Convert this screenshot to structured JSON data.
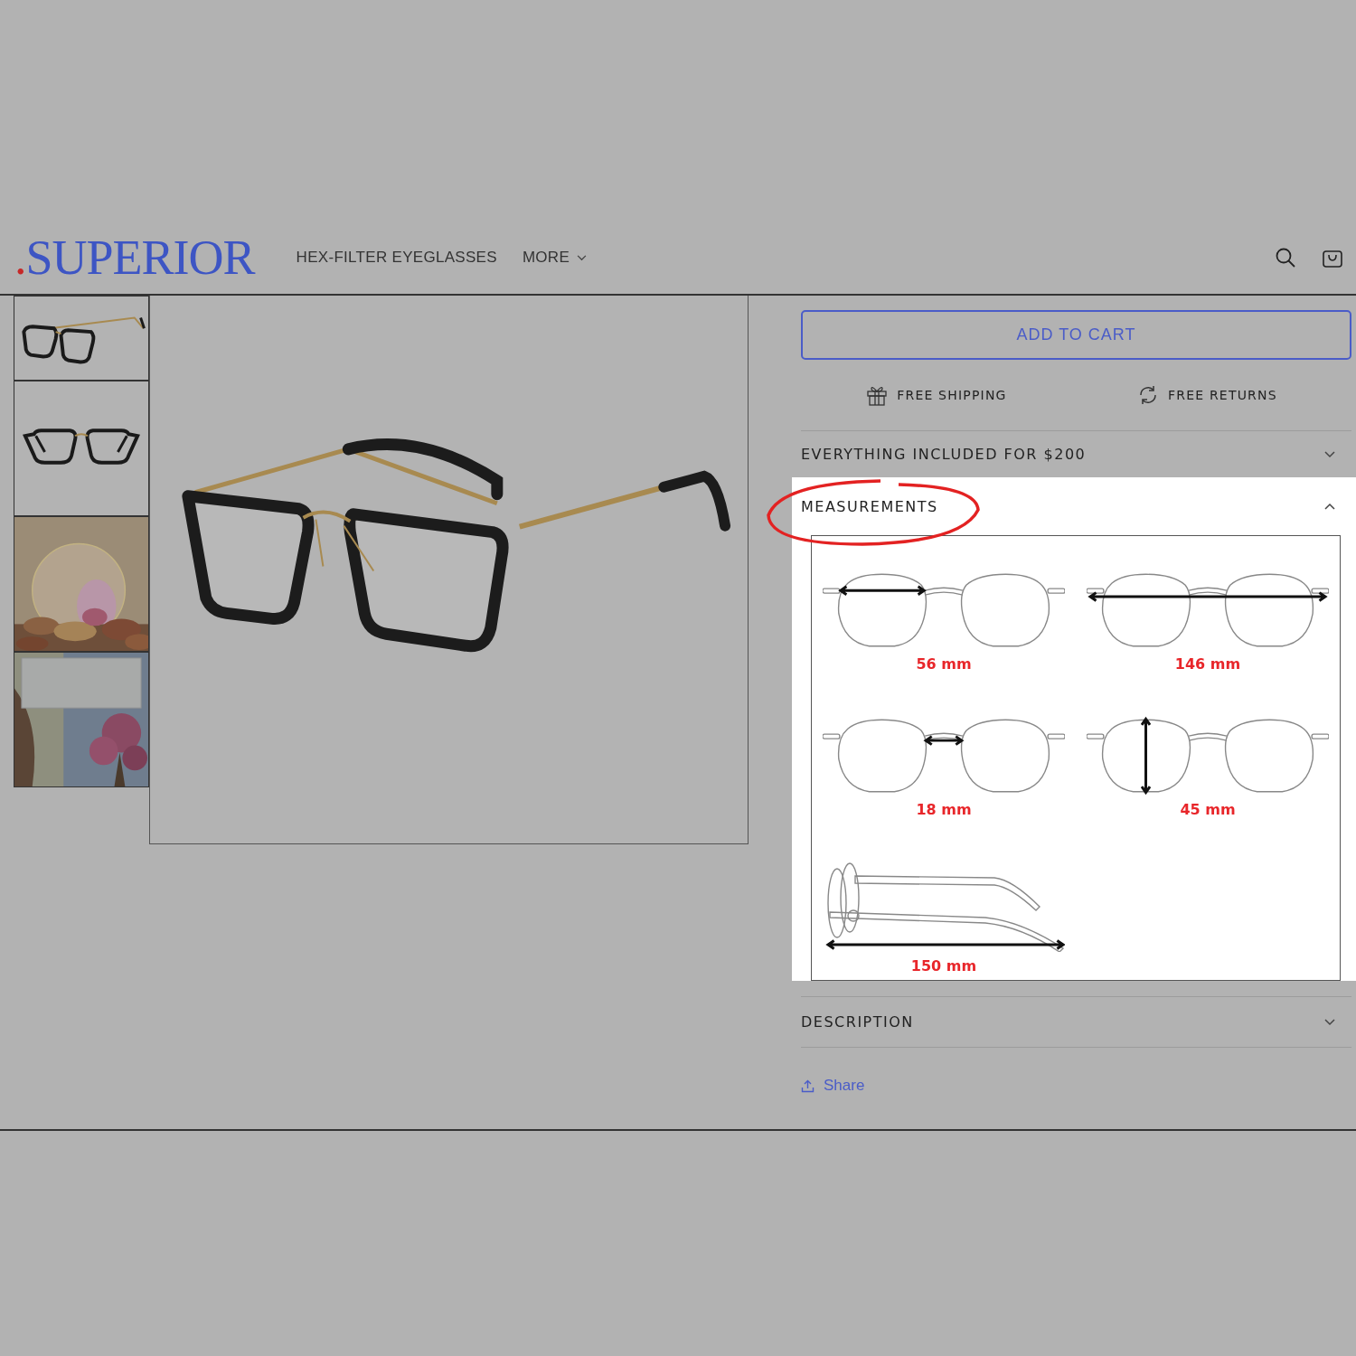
{
  "header": {
    "logo": {
      "dot": ".",
      "name": "SUPERIOR"
    },
    "nav": [
      {
        "label": "HEX-FILTER EYEGLASSES",
        "dropdown": false
      },
      {
        "label": "MORE",
        "dropdown": true
      }
    ]
  },
  "product": {
    "add_to_cart": "ADD TO CART",
    "benefits": [
      {
        "kind": "gift",
        "label": "FREE SHIPPING"
      },
      {
        "kind": "returns",
        "label": "FREE RETURNS"
      }
    ],
    "accordions": [
      {
        "title": "EVERYTHING INCLUDED FOR $200",
        "expanded": false,
        "highlighted": false
      },
      {
        "title": "MEASUREMENTS",
        "expanded": true,
        "highlighted": true,
        "measurements": [
          {
            "kind": "lens-width",
            "label": "56 mm"
          },
          {
            "kind": "frame-width",
            "label": "146 mm"
          },
          {
            "kind": "bridge",
            "label": "18 mm"
          },
          {
            "kind": "lens-height",
            "label": "45 mm"
          },
          {
            "kind": "temple",
            "label": "150 mm"
          }
        ]
      },
      {
        "title": "DESCRIPTION",
        "expanded": false,
        "highlighted": false
      }
    ],
    "share": "Share"
  }
}
